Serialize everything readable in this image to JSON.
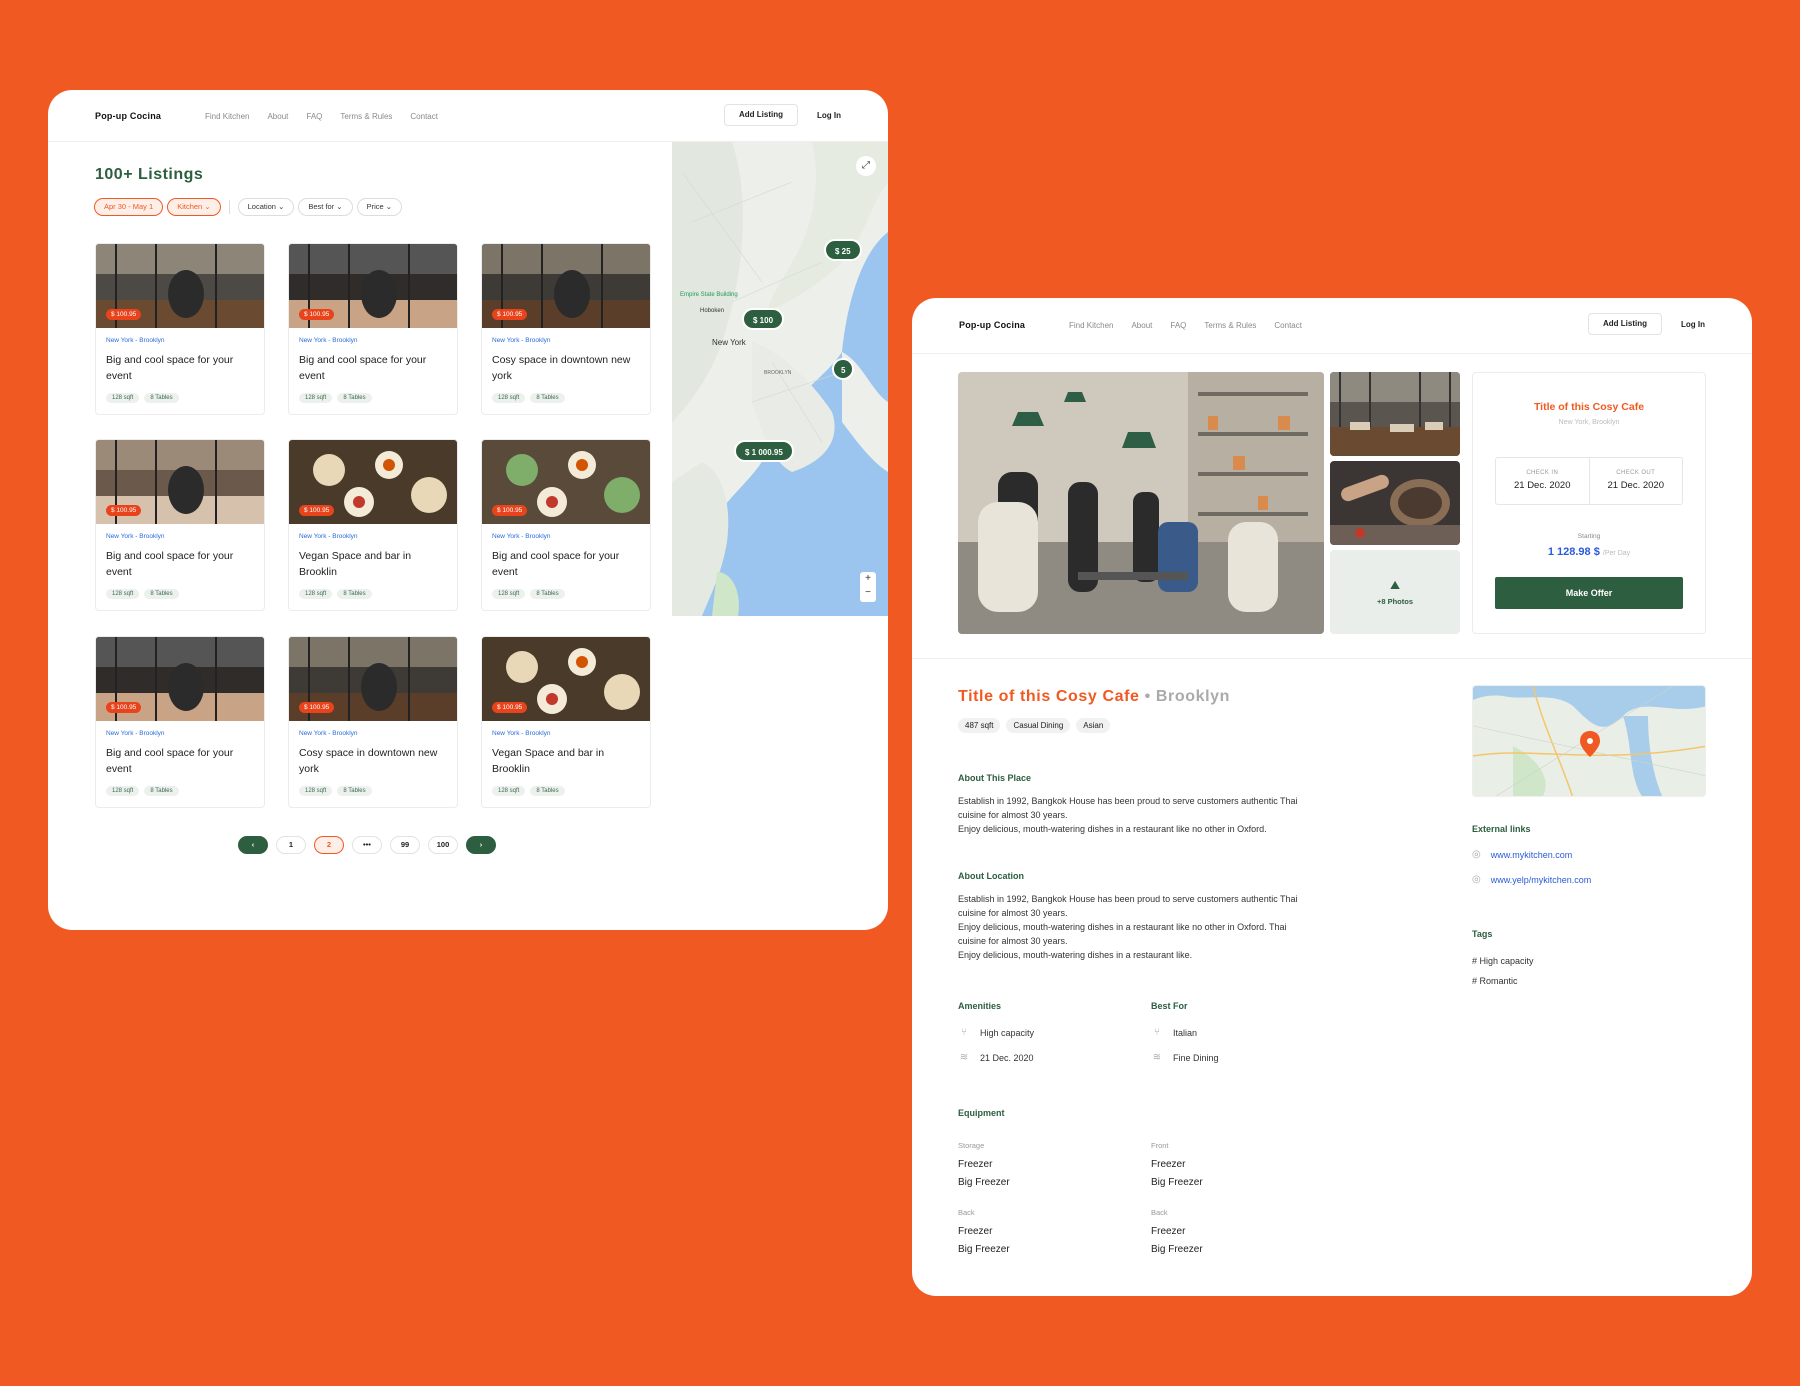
{
  "nav": {
    "brand": "Pop-up Cocina",
    "links": [
      "Find Kitchen",
      "About",
      "FAQ",
      "Terms & Rules",
      "Contact"
    ],
    "add_listing": "Add Listing",
    "login": "Log In"
  },
  "listings_page": {
    "title": "100+ Listings",
    "filters": {
      "date": "Apr 30 - May 1",
      "type": "Kitchen",
      "location": "Location",
      "best_for": "Best for",
      "price": "Price"
    },
    "cards": [
      {
        "price": "$ 100.95",
        "location": "New York - Brooklyn",
        "title": "Big and cool space for your event",
        "tags": [
          "128 sqft",
          "8 Tables"
        ]
      },
      {
        "price": "$ 100.95",
        "location": "New York - Brooklyn",
        "title": "Big and cool space for your event",
        "tags": [
          "128 sqft",
          "8 Tables"
        ]
      },
      {
        "price": "$ 100.95",
        "location": "New York - Brooklyn",
        "title": "Cosy space in downtown new york",
        "tags": [
          "128 sqft",
          "8 Tables"
        ]
      },
      {
        "price": "$ 100.95",
        "location": "New York - Brooklyn",
        "title": "Big and cool space for your event",
        "tags": [
          "128 sqft",
          "8 Tables"
        ]
      },
      {
        "price": "$ 100.95",
        "location": "New York - Brooklyn",
        "title": "Vegan Space and bar in Brooklin",
        "tags": [
          "128 sqft",
          "8 Tables"
        ]
      },
      {
        "price": "$ 100.95",
        "location": "New York - Brooklyn",
        "title": "Big and cool space for your event",
        "tags": [
          "128 sqft",
          "8 Tables"
        ]
      },
      {
        "price": "$ 100.95",
        "location": "New York - Brooklyn",
        "title": "Big and cool space for your event",
        "tags": [
          "128 sqft",
          "8 Tables"
        ]
      },
      {
        "price": "$ 100.95",
        "location": "New York - Brooklyn",
        "title": "Cosy space in downtown new york",
        "tags": [
          "128 sqft",
          "8 Tables"
        ]
      },
      {
        "price": "$ 100.95",
        "location": "New York - Brooklyn",
        "title": "Vegan Space and bar in Brooklin",
        "tags": [
          "128 sqft",
          "8 Tables"
        ]
      }
    ],
    "pagination": {
      "prev": "‹",
      "pages": [
        "1",
        "2",
        "•••",
        "99",
        "100"
      ],
      "active": "2",
      "next": "›"
    },
    "map": {
      "pins": [
        "$ 25",
        "$ 100",
        "5",
        "$ 1 000.95"
      ],
      "labels": [
        "New York",
        "Hoboken",
        "Empire State Building",
        "BROOKLYN"
      ],
      "zoom_in": "+",
      "zoom_out": "−",
      "expand_icon": "⤢"
    }
  },
  "detail_page": {
    "booking": {
      "title": "Title of this Cosy Cafe",
      "subtitle": "New York, Brooklyn",
      "check_in_label": "CHECK IN",
      "check_in": "21 Dec. 2020",
      "check_out_label": "CHECK OUT",
      "check_out": "21 Dec. 2020",
      "starting_label": "Starting",
      "price": "1 128.98 $",
      "per": "/Per Day",
      "cta": "Make Offer"
    },
    "gallery": {
      "more_photos": "+8 Photos"
    },
    "title": "Title of this Cosy Cafe",
    "title_sub": "• Brooklyn",
    "tags": [
      "487 sqft",
      "Casual Dining",
      "Asian"
    ],
    "about_place": {
      "heading": "About This Place",
      "lines": [
        "Establish in 1992, Bangkok House has been proud to serve customers authentic Thai",
        "cuisine for almost 30 years.",
        "Enjoy delicious, mouth-watering dishes in a restaurant like no other in Oxford."
      ]
    },
    "about_location": {
      "heading": "About Location",
      "lines": [
        "Establish in 1992, Bangkok House has been proud to serve customers authentic Thai",
        "cuisine for almost 30 years.",
        "Enjoy delicious, mouth-watering dishes in a restaurant like no other in Oxford. Thai",
        "cuisine for almost 30 years.",
        "Enjoy delicious, mouth-watering dishes in a restaurant like."
      ]
    },
    "amenities": {
      "heading": "Amenities",
      "items": [
        "High capacity",
        "21 Dec. 2020"
      ]
    },
    "best_for": {
      "heading": "Best For",
      "items": [
        "Italian",
        "Fine Dining"
      ]
    },
    "equipment": {
      "heading": "Equipment",
      "groups": [
        {
          "label": "Storage",
          "items": [
            "Freezer",
            "Big Freezer"
          ]
        },
        {
          "label": "Front",
          "items": [
            "Freezer",
            "Big Freezer"
          ]
        },
        {
          "label": "Back",
          "items": [
            "Freezer",
            "Big Freezer"
          ]
        },
        {
          "label": "Back",
          "items": [
            "Freezer",
            "Big Freezer"
          ]
        }
      ]
    },
    "external_links": {
      "heading": "External links",
      "items": [
        "www.mykitchen.com",
        "www.yelp/mykitchen.com"
      ]
    },
    "tags_section": {
      "heading": "Tags",
      "items": [
        "# High capacity",
        "# Romantic"
      ]
    }
  },
  "colors": {
    "background": "#F05A22",
    "brand_green": "#2C5E3F",
    "accent_orange": "#F05A22",
    "link_blue": "#2A6BD8"
  }
}
